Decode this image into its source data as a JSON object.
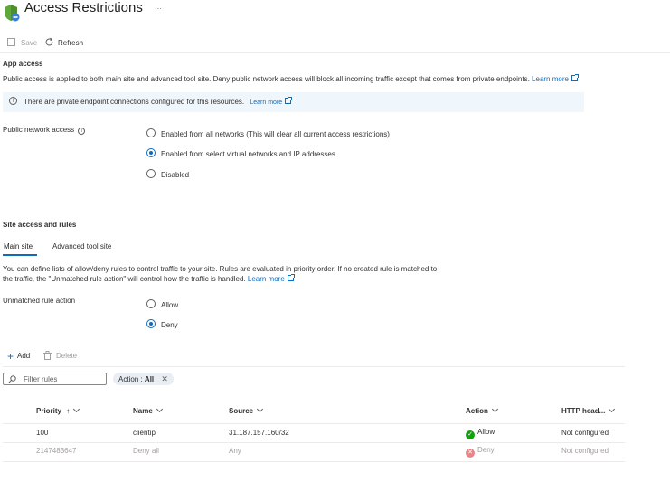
{
  "header": {
    "title": "Access Restrictions",
    "more": "···"
  },
  "toolbar": {
    "save": "Save",
    "refresh": "Refresh"
  },
  "app_access": {
    "heading": "App access",
    "description": "Public access is applied to both main site and advanced tool site. Deny public network access will block all incoming traffic except that comes from private endpoints.",
    "learn_more": "Learn more",
    "info_text": "There are private endpoint connections configured for this resources.",
    "info_learn_more": "Learn more",
    "public_network_label": "Public network access",
    "options": [
      "Enabled from all networks (This will clear all current access restrictions)",
      "Enabled from select virtual networks and IP addresses",
      "Disabled"
    ],
    "selected_option": 1
  },
  "site_access": {
    "heading": "Site access and rules",
    "tabs": [
      "Main site",
      "Advanced tool site"
    ],
    "active_tab": 0,
    "description_line1": "You can define lists of allow/deny rules to control traffic to your site. Rules are evaluated in priority order. If no created rule is matched to",
    "description_line2": "the traffic, the \"Unmatched rule action\" will control how the traffic is handled.",
    "learn_more": "Learn more",
    "unmatched_label": "Unmatched rule action",
    "unmatched_options": [
      "Allow",
      "Deny"
    ],
    "unmatched_selected": 1
  },
  "rules_toolbar": {
    "add": "Add",
    "delete": "Delete"
  },
  "filter": {
    "placeholder": "Filter rules",
    "chip_label": "Action :",
    "chip_value": "All"
  },
  "table": {
    "columns": [
      "Priority",
      "Name",
      "Source",
      "Action",
      "HTTP head..."
    ],
    "priority_sort": "↑",
    "rows": [
      {
        "priority": "100",
        "name": "clientip",
        "source": "31.187.157.160/32",
        "action": "Allow",
        "http": "Not configured"
      },
      {
        "priority": "2147483647",
        "name": "Deny all",
        "source": "Any",
        "action": "Deny",
        "http": "Not configured"
      }
    ]
  },
  "colors": {
    "accent": "#0f6cbd",
    "allow": "#13a10e",
    "deny": "#d13438",
    "info_bg": "#eff6fc"
  }
}
